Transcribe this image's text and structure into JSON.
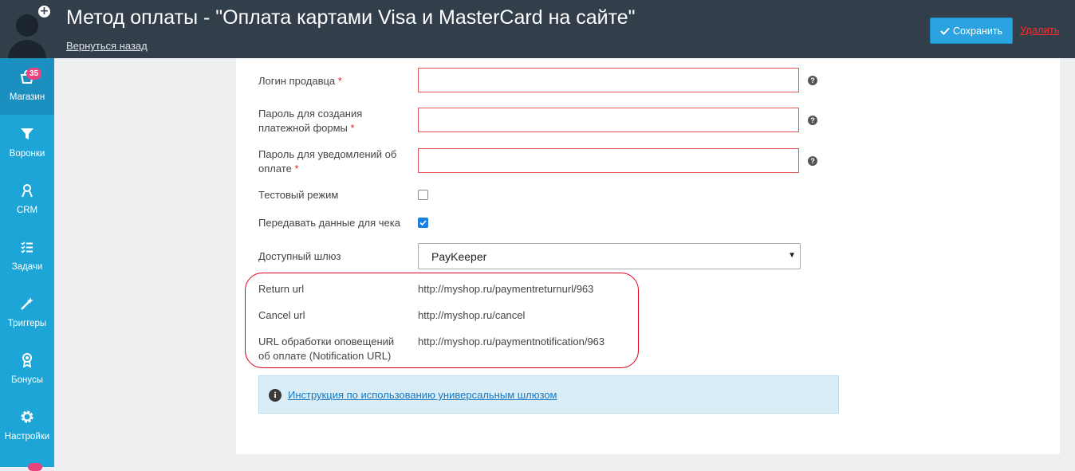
{
  "header": {
    "title": "Метод оплаты - \"Оплата картами Visa и MasterCard на сайте\"",
    "back_label": "Вернуться назад",
    "save_label": "Сохранить",
    "delete_label": "Удалить"
  },
  "sidebar": {
    "items": [
      {
        "label": "Магазин",
        "icon": "shop-icon",
        "badge": "35"
      },
      {
        "label": "Воронки",
        "icon": "funnel-icon"
      },
      {
        "label": "CRM",
        "icon": "user-icon"
      },
      {
        "label": "Задачи",
        "icon": "tasks-icon"
      },
      {
        "label": "Триггеры",
        "icon": "magic-wand-icon"
      },
      {
        "label": "Бонусы",
        "icon": "award-icon"
      },
      {
        "label": "Настройки",
        "icon": "gear-icon"
      }
    ]
  },
  "form": {
    "seller_login": {
      "label": "Логин продавца",
      "required": "*",
      "value": ""
    },
    "payment_form_password": {
      "label_line1": "Пароль для создания",
      "label_line2": "платежной формы",
      "required": "*",
      "value": ""
    },
    "notification_password": {
      "label_line1": "Пароль для уведомлений об",
      "label_line2": "оплате",
      "required": "*",
      "value": ""
    },
    "test_mode": {
      "label": "Тестовый режим",
      "checked": false
    },
    "send_receipt": {
      "label": "Передавать данные для чека",
      "checked": true
    },
    "gateway": {
      "label": "Доступный шлюз",
      "value": "PayKeeper"
    },
    "return_url": {
      "label": "Return url",
      "value": "http://myshop.ru/paymentreturnurl/963"
    },
    "cancel_url": {
      "label": "Cancel url",
      "value": "http://myshop.ru/cancel"
    },
    "notification_url": {
      "label_line1": "URL обработки оповещений",
      "label_line2": "об оплате (Notification URL)",
      "value": "http://myshop.ru/paymentnotification/963"
    }
  },
  "info": {
    "link_label": "Инструкция по использованию универсальным шлюзом"
  },
  "colors": {
    "sidebar": "#1ea5d8",
    "header": "#323f4b",
    "accent": "#2aa3e0",
    "danger": "#ff2a2a",
    "badge": "#e8457f"
  }
}
